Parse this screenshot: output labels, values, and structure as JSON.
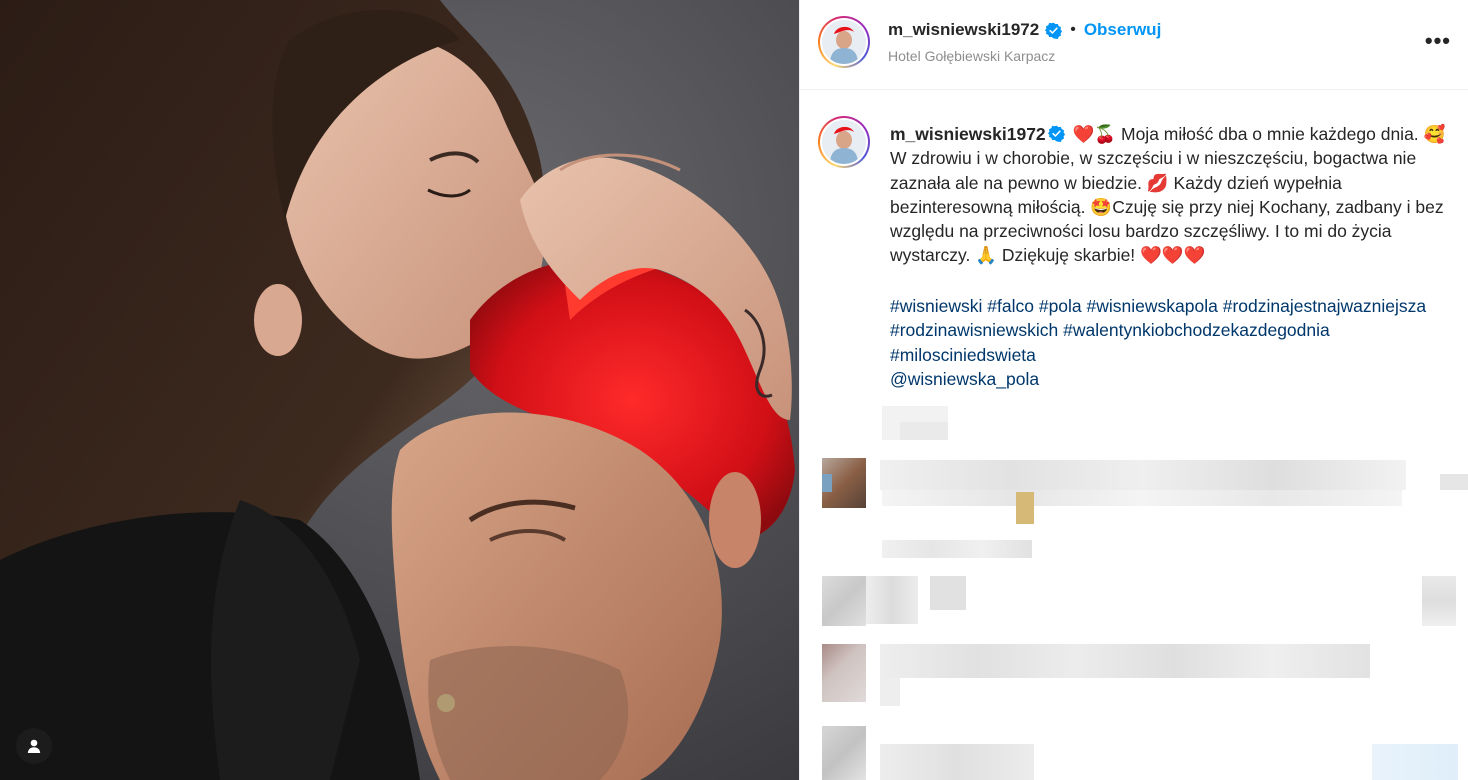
{
  "header": {
    "username": "m_wisniewski1972",
    "separator": "•",
    "follow_label": "Obserwuj",
    "location": "Hotel Gołębiewski Karpacz",
    "more_label": "•••"
  },
  "caption": {
    "username": "m_wisniewski1972",
    "line1": "Moja miłość dba o mnie każdego dnia.",
    "line2": "W zdrowiu i w chorobie, w szczęściu i w nieszczęściu, bogactwa nie zaznała ale na pewno w biedzie.",
    "line3": "Każdy dzień wypełnia bezinteresowną miłością.",
    "line4": "Czuję się przy niej Kochany, zadbany i bez względu na przeciwności losu bardzo szczęśliwy. I to mi do życia wystarczy.",
    "line5": "Dziękuję skarbie!",
    "emoji": {
      "heart": "❤️",
      "cherries": "🍒",
      "smiling_hearts": "🥰",
      "lips": "💋",
      "star_eyes": "🤩",
      "pray": "🙏",
      "hearts3": "❤️❤️❤️"
    },
    "hashtags": [
      "#wisniewski",
      "#falco",
      "#pola",
      "#wisniewskapola",
      "#rodzinajestnajwazniejsza",
      "#rodzinawisniewskich",
      "#walentynkiobchodzekazdegodnia",
      "#milosciniedswieta",
      "@wisniewska_pola"
    ]
  },
  "colors": {
    "link": "#00376b",
    "follow": "#0095f6",
    "muted": "#8e8e8e",
    "verified": "#0095f6",
    "hair": "#e8131a"
  },
  "icons": {
    "user_tag": "person-icon",
    "verified": "verified-badge-icon",
    "more": "more-horizontal-icon"
  }
}
